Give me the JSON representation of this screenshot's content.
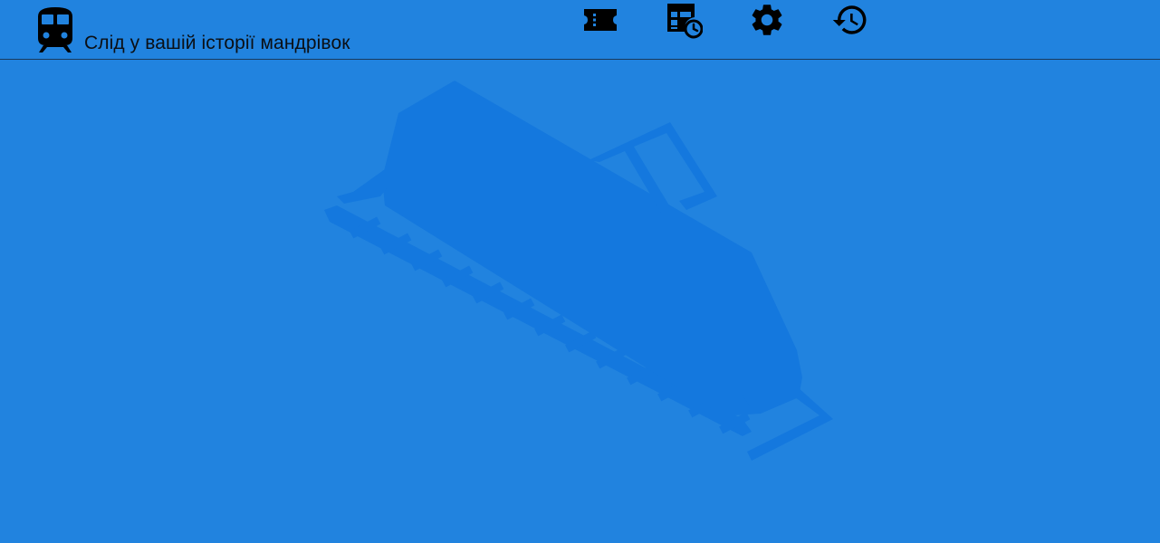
{
  "header": {
    "tagline": "Слід у вашій історії мандрівок",
    "logo_icon": "train-icon",
    "nav": [
      {
        "icon": "ticket-icon"
      },
      {
        "icon": "schedule-calendar-icon"
      },
      {
        "icon": "gear-icon"
      },
      {
        "icon": "history-icon"
      }
    ]
  },
  "main": {
    "background_illustration": "train-on-tracks-icon"
  },
  "colors": {
    "background": "#2183df",
    "illustration": "#1478de",
    "icon": "#000000",
    "divider": "#1a3a5c"
  }
}
